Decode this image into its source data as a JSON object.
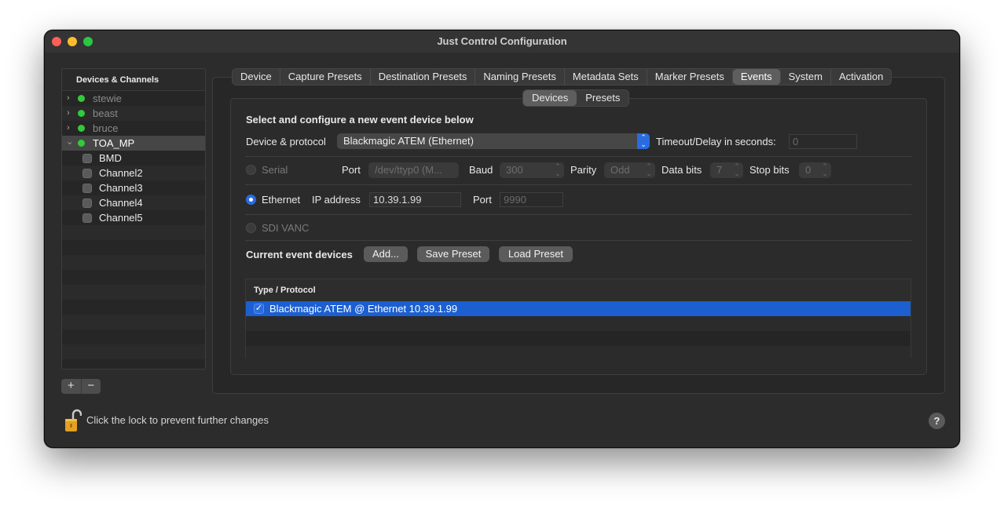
{
  "window": {
    "title": "Just Control Configuration"
  },
  "sidebar": {
    "header": "Devices & Channels",
    "devices": [
      {
        "name": "stewie",
        "expanded": false,
        "status_color": "#32c93a"
      },
      {
        "name": "beast",
        "expanded": false,
        "status_color": "#32c93a"
      },
      {
        "name": "bruce",
        "expanded": false,
        "status_color": "#32c93a"
      },
      {
        "name": "TOA_MP",
        "expanded": true,
        "status_color": "#32c93a"
      }
    ],
    "channels": [
      "BMD",
      "Channel2",
      "Channel3",
      "Channel4",
      "Channel5"
    ],
    "add_label": "+",
    "remove_label": "−"
  },
  "tabs": [
    "Device",
    "Capture Presets",
    "Destination Presets",
    "Naming Presets",
    "Metadata Sets",
    "Marker Presets",
    "Events",
    "System",
    "Activation"
  ],
  "active_tab": "Events",
  "subtabs": [
    "Devices",
    "Presets"
  ],
  "active_subtab": "Devices",
  "events": {
    "heading": "Select and configure a new event device below",
    "device_protocol_label": "Device & protocol",
    "device_protocol_value": "Blackmagic ATEM (Ethernet)",
    "timeout_label": "Timeout/Delay in seconds:",
    "timeout_value": "0",
    "serial": {
      "label": "Serial",
      "port_label": "Port",
      "port_value": "/dev/ttyp0 (M...",
      "baud_label": "Baud",
      "baud_value": "300",
      "parity_label": "Parity",
      "parity_value": "Odd",
      "databits_label": "Data bits",
      "databits_value": "7",
      "stopbits_label": "Stop bits",
      "stopbits_value": "0"
    },
    "ethernet": {
      "label": "Ethernet",
      "ip_label": "IP address",
      "ip_value": "10.39.1.99",
      "port_label": "Port",
      "port_placeholder": "9990"
    },
    "sdi_label": "SDI VANC",
    "current_label": "Current event devices",
    "add_button": "Add...",
    "save_button": "Save Preset",
    "load_button": "Load Preset",
    "table_header": "Type / Protocol",
    "rows": [
      "Blackmagic ATEM @ Ethernet 10.39.1.99"
    ]
  },
  "footer": {
    "lock_text": "Click the lock to prevent further changes",
    "help_label": "?"
  }
}
